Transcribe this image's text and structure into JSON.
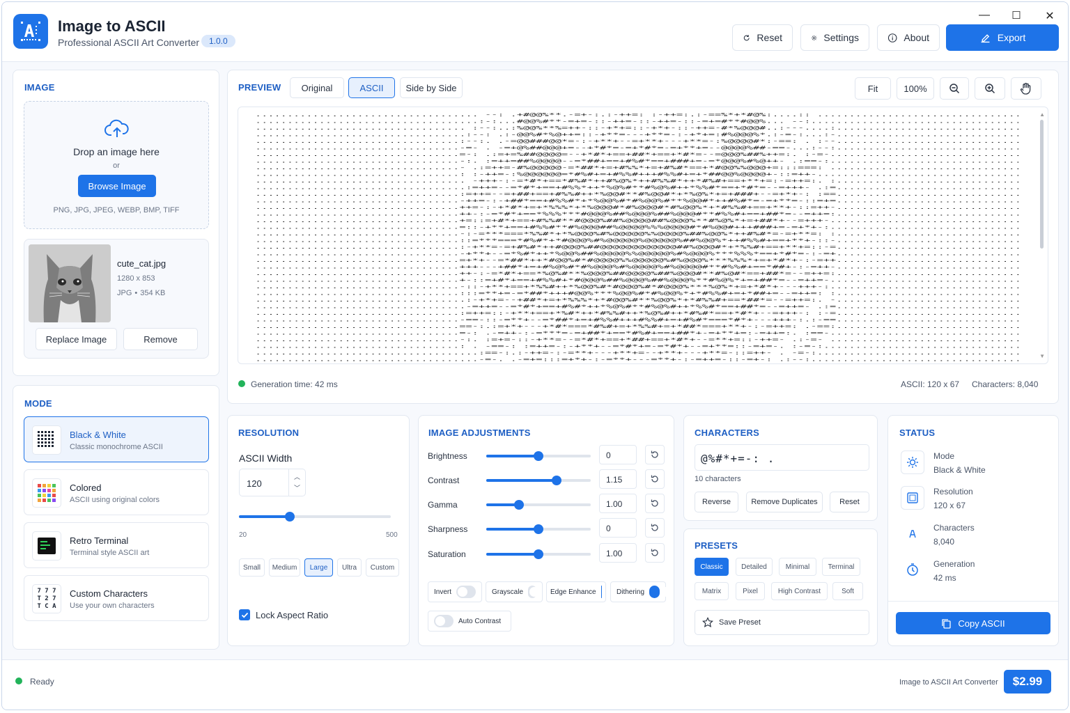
{
  "app": {
    "title": "Image to ASCII",
    "subtitle": "Professional ASCII Art Converter",
    "version": "1.0.0"
  },
  "window": {
    "minimize": "—",
    "maximize": "☐",
    "close": "✕"
  },
  "toolbar": {
    "reset": "Reset",
    "settings": "Settings",
    "about": "About",
    "export": "Export"
  },
  "image_panel": {
    "title": "IMAGE",
    "drop_text": "Drop an image here",
    "or": "or",
    "browse": "Browse Image",
    "formats": "PNG, JPG, JPEG, WEBP, BMP, TIFF",
    "file": {
      "name": "cute_cat.jpg",
      "dimensions": "1280 x 853",
      "type": "JPG",
      "separator": "•",
      "size": "354 KB"
    },
    "replace": "Replace Image",
    "remove": "Remove"
  },
  "mode_panel": {
    "title": "MODE",
    "modes": [
      {
        "title": "Black & White",
        "desc": "Classic monochrome ASCII",
        "active": true
      },
      {
        "title": "Colored",
        "desc": "ASCII using original colors",
        "active": false
      },
      {
        "title": "Retro Terminal",
        "desc": "Terminal style ASCII art",
        "active": false
      },
      {
        "title": "Custom Characters",
        "desc": "Use your own characters",
        "active": false
      }
    ],
    "custom_icon_glyphs": [
      "7 7 7",
      "T 2 7",
      "T C A"
    ]
  },
  "preview": {
    "title": "PREVIEW",
    "tabs": [
      {
        "label": "Original",
        "active": false
      },
      {
        "label": "ASCII",
        "active": true
      },
      {
        "label": "Side by Side",
        "active": false
      }
    ],
    "fit": "Fit",
    "zoom": "100%",
    "generation": "Generation time: 42 ms",
    "ascii_size": "ASCII: 120 x 67",
    "characters": "Characters: 8,040"
  },
  "resolution": {
    "title": "RESOLUTION",
    "width_label": "ASCII Width",
    "width_value": "120",
    "slider_min": "20",
    "slider_max": "500",
    "slider_value": 120,
    "sizes": [
      {
        "label": "Small",
        "active": false
      },
      {
        "label": "Medium",
        "active": false
      },
      {
        "label": "Large",
        "active": true
      },
      {
        "label": "Ultra",
        "active": false
      },
      {
        "label": "Custom",
        "active": false
      }
    ],
    "lock_aspect": "Lock Aspect Ratio",
    "lock_checked": true
  },
  "adjustments": {
    "title": "IMAGE ADJUSTMENTS",
    "sliders": [
      {
        "label": "Brightness",
        "value": "0",
        "level": 0.5
      },
      {
        "label": "Contrast",
        "value": "1.15",
        "level": 0.67
      },
      {
        "label": "Gamma",
        "value": "1.00",
        "level": 0.31
      },
      {
        "label": "Sharpness",
        "value": "0",
        "level": 0.5
      },
      {
        "label": "Saturation",
        "value": "1.00",
        "level": 0.5
      }
    ],
    "toggles": [
      {
        "label": "Invert",
        "on": false
      },
      {
        "label": "Grayscale",
        "on": false
      },
      {
        "label": "Edge Enhance",
        "on": true
      },
      {
        "label": "Dithering",
        "on": true
      },
      {
        "label": "Auto Contrast",
        "on": false
      }
    ]
  },
  "characters": {
    "title": "CHARACTERS",
    "set": "@%#*+=-: .",
    "count": "10 characters",
    "reverse": "Reverse",
    "remove_dup": "Remove Duplicates",
    "reset": "Reset"
  },
  "presets": {
    "title": "PRESETS",
    "items": [
      {
        "label": "Classic",
        "active": true
      },
      {
        "label": "Detailed",
        "active": false
      },
      {
        "label": "Minimal",
        "active": false
      },
      {
        "label": "Terminal",
        "active": false
      },
      {
        "label": "Matrix",
        "active": false
      },
      {
        "label": "Pixel",
        "active": false
      },
      {
        "label": "High Contrast",
        "active": false
      },
      {
        "label": "Soft",
        "active": false
      }
    ],
    "save": "Save Preset"
  },
  "status": {
    "title": "STATUS",
    "items": [
      {
        "label": "Mode",
        "value": "Black & White",
        "icon": "sun-icon"
      },
      {
        "label": "Resolution",
        "value": "120 x 67",
        "icon": "frame-icon"
      },
      {
        "label": "Characters",
        "value": "8,040",
        "icon": "text-icon"
      },
      {
        "label": "Generation",
        "value": "42 ms",
        "icon": "timer-icon"
      }
    ],
    "copy": "Copy ASCII"
  },
  "statusbar": {
    "state": "Ready",
    "app_name": "Image to ASCII Art Converter",
    "price": "$2.99"
  },
  "colors": {
    "accent": "#1e73e8",
    "ready": "#22b35a",
    "heading": "#1e5fc4"
  }
}
